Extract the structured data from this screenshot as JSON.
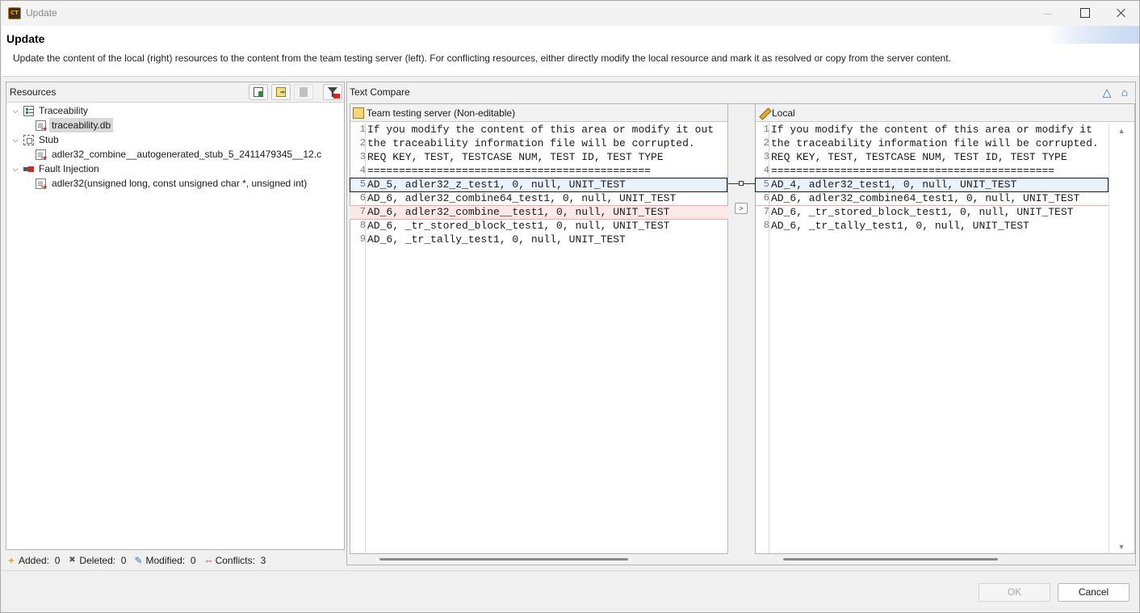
{
  "window": {
    "title": "Update",
    "app_icon_text": "CT"
  },
  "header": {
    "title": "Update",
    "description": "Update the content of the local (right) resources to the content from the team testing server (left). For conflicting resources, either directly modify the local resource and mark it as resolved or copy from the server content."
  },
  "resources": {
    "title": "Resources",
    "tree": [
      {
        "label": "Traceability",
        "icon": "traceability-icon",
        "expanded": true
      },
      {
        "label": "traceability.db",
        "icon": "conflict-file-icon",
        "selected": true
      },
      {
        "label": "Stub",
        "icon": "stub-icon",
        "expanded": true
      },
      {
        "label": "adler32_combine__autogenerated_stub_5_2411479345__12.c",
        "icon": "conflict-file-icon"
      },
      {
        "label": "Fault Injection",
        "icon": "fault-injection-icon",
        "expanded": true
      },
      {
        "label": "adler32(unsigned long, const unsigned char *, unsigned int)",
        "icon": "conflict-file-icon"
      }
    ],
    "status": {
      "added_label": "Added:",
      "added": "0",
      "deleted_label": "Deleted:",
      "deleted": "0",
      "modified_label": "Modified:",
      "modified": "0",
      "conflicts_label": "Conflicts:",
      "conflicts": "3"
    }
  },
  "compare": {
    "title": "Text Compare",
    "left": {
      "title": "Team testing server (Non-editable)",
      "lines": [
        {
          "n": "1",
          "text": "If you modify the content of this area or modify it out"
        },
        {
          "n": "2",
          "text": "the traceability information file will be corrupted."
        },
        {
          "n": "3",
          "text": "REQ KEY, TEST, TESTCASE NUM, TEST ID, TEST TYPE"
        },
        {
          "n": "4",
          "text": "============================================="
        },
        {
          "n": "5",
          "text": "AD_5, adler32_z_test1, 0, null, UNIT_TEST"
        },
        {
          "n": "6",
          "text": "AD_6, adler32_combine64_test1, 0, null, UNIT_TEST"
        },
        {
          "n": "7",
          "text": "AD_6, adler32_combine__test1, 0, null, UNIT_TEST"
        },
        {
          "n": "8",
          "text": "AD_6, _tr_stored_block_test1, 0, null, UNIT_TEST"
        },
        {
          "n": "9",
          "text": "AD_6, _tr_tally_test1, 0, null, UNIT_TEST"
        }
      ]
    },
    "right": {
      "title": "Local",
      "lines": [
        {
          "n": "1",
          "text": "If you modify the content of this area or modify it"
        },
        {
          "n": "2",
          "text": "the traceability information file will be corrupted."
        },
        {
          "n": "3",
          "text": "REQ KEY, TEST, TESTCASE NUM, TEST ID, TEST TYPE"
        },
        {
          "n": "4",
          "text": "============================================="
        },
        {
          "n": "5",
          "text": "AD_4, adler32_test1, 0, null, UNIT_TEST"
        },
        {
          "n": "6",
          "text": "AD_6, adler32_combine64_test1, 0, null, UNIT_TEST"
        },
        {
          "n": "7",
          "text": "AD_6, _tr_stored_block_test1, 0, null, UNIT_TEST"
        },
        {
          "n": "8",
          "text": "AD_6, _tr_tally_test1, 0, null, UNIT_TEST"
        }
      ]
    },
    "copy_button_label": ">"
  },
  "buttons": {
    "ok": "OK",
    "cancel": "Cancel"
  },
  "colors": {
    "conflict": "#d9231d",
    "changed_bg": "#eaf2fb",
    "removed_bg": "#fde8e8"
  }
}
